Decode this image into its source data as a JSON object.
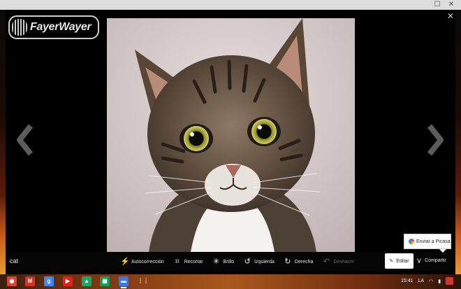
{
  "window": {
    "maximize_icon": "maximize-icon",
    "close_icon": "close-icon"
  },
  "logo": {
    "text": "FayerWayer"
  },
  "viewer": {
    "caption": "cat",
    "photo_subject": "tabby-cat-photo",
    "tools": [
      {
        "name": "autocorrect",
        "label": "Autocorrección",
        "icon": "magic-wand-icon",
        "glyph": "⚡",
        "enabled": true
      },
      {
        "name": "crop",
        "label": "Recortar",
        "icon": "crop-icon",
        "glyph": "⌗",
        "enabled": true
      },
      {
        "name": "brightness",
        "label": "Brillo",
        "icon": "sun-icon",
        "glyph": "✳",
        "enabled": true
      },
      {
        "name": "rotate-left",
        "label": "Izquierda",
        "icon": "rotate-left-icon",
        "glyph": "↺",
        "enabled": true
      },
      {
        "name": "rotate-right",
        "label": "Derecha",
        "icon": "rotate-right-icon",
        "glyph": "↻",
        "enabled": true
      },
      {
        "name": "undo",
        "label": "Deshacer",
        "icon": "undo-icon",
        "glyph": "↶",
        "enabled": false
      }
    ],
    "edit_label": "Editar",
    "share_label": "Compartir",
    "popup_label": "Enviar a Picasa"
  },
  "shelf": {
    "apps": [
      {
        "name": "chrome",
        "icon": "chrome-icon",
        "color": "#db4437",
        "glyph": "◉"
      },
      {
        "name": "gmail",
        "icon": "gmail-icon",
        "color": "#d93025",
        "glyph": "M"
      },
      {
        "name": "google-search",
        "icon": "google-icon",
        "color": "#4285f4",
        "glyph": "g"
      },
      {
        "name": "youtube",
        "icon": "youtube-icon",
        "color": "#e62117",
        "glyph": "▶"
      },
      {
        "name": "drive",
        "icon": "drive-icon",
        "color": "#1fa463",
        "glyph": "▲"
      },
      {
        "name": "sheets",
        "icon": "sheets-icon",
        "color": "#0f9d58",
        "glyph": "▦"
      },
      {
        "name": "files",
        "icon": "files-icon",
        "color": "#3b78e7",
        "glyph": "▬"
      },
      {
        "name": "app-launcher",
        "icon": "app-launcher-icon",
        "color": "transparent",
        "glyph": "⋮⋮"
      }
    ],
    "active_app": "files",
    "time": "15:41",
    "input_method": "LA"
  }
}
